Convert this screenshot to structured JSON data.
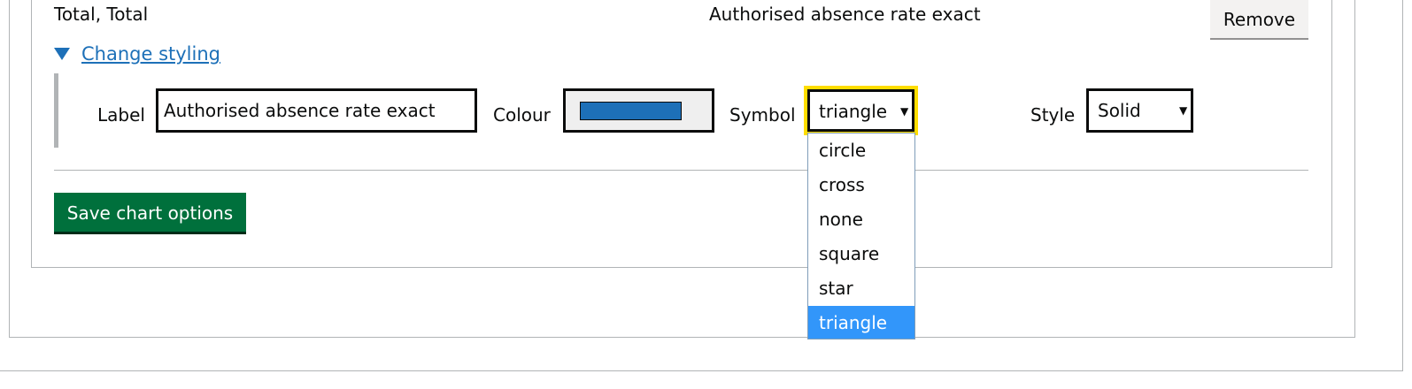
{
  "series": {
    "name": "Total, Total",
    "indicator": "Authorised absence rate exact",
    "remove_label": "Remove"
  },
  "styling": {
    "toggle_label": "Change styling",
    "label_field_label": "Label",
    "label_value": "Authorised absence rate exact",
    "colour_label": "Colour",
    "colour_value": "#1d70b8",
    "symbol_label": "Symbol",
    "symbol_value": "triangle",
    "symbol_options": [
      "circle",
      "cross",
      "none",
      "square",
      "star",
      "triangle"
    ],
    "style_label": "Style",
    "style_value": "Solid"
  },
  "save_label": "Save chart options"
}
